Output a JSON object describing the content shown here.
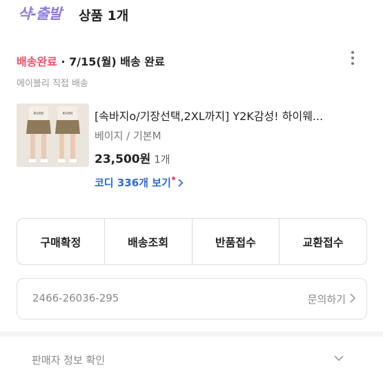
{
  "header": {
    "brand": "샥-출발",
    "title": "상품 1개"
  },
  "order": {
    "status": "배송완료",
    "separator": " · ",
    "date_text": "7/15(월) 배송 완료",
    "seller_note": "에이블리 직접 배송",
    "number": "2466-26036-295",
    "inquiry_label": "문의하기"
  },
  "product": {
    "name": "[속바지o/기장선택,2XL까지] Y2K감성! 하이웨...",
    "option": "베이지 / 기본M",
    "price": "23,500원",
    "quantity": "1개",
    "codi_label": "코디 336개 보기",
    "thumb_text": "RIVER"
  },
  "actions": [
    "구매확정",
    "배송조회",
    "반품접수",
    "교환접수"
  ],
  "seller_info_label": "판매자 정보 확인",
  "colors": {
    "accent": "#f04d68",
    "link": "#2d6ad6",
    "brand": "#8a7ce0"
  }
}
